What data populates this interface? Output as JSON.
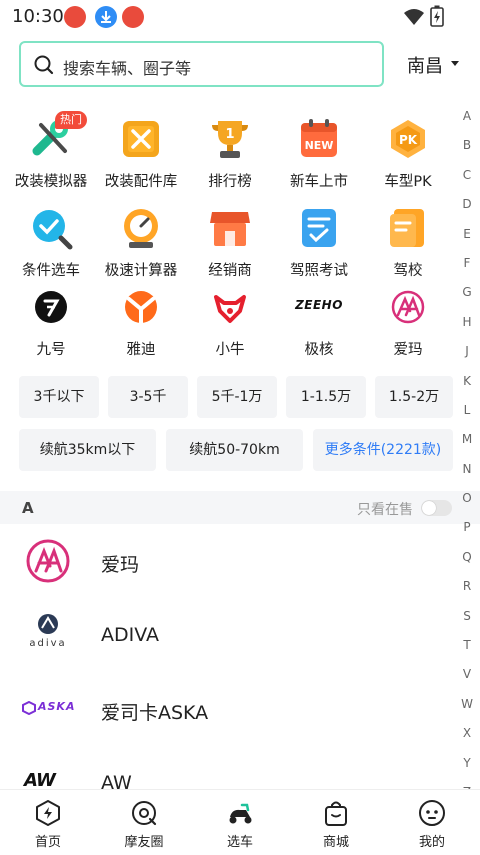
{
  "status_bar": {
    "time": "10:30"
  },
  "search": {
    "placeholder": "搜索车辆、圈子等"
  },
  "location": {
    "city": "南昌"
  },
  "tools": [
    {
      "label": "改装模拟器",
      "badge": "热门",
      "icon": "wrench-icon"
    },
    {
      "label": "改装配件库",
      "icon": "parts-box-icon"
    },
    {
      "label": "排行榜",
      "icon": "trophy-icon"
    },
    {
      "label": "新车上市",
      "icon": "new-calendar-icon"
    },
    {
      "label": "车型PK",
      "icon": "pk-icon"
    },
    {
      "label": "条件选车",
      "icon": "magnifier-check-icon"
    },
    {
      "label": "极速计算器",
      "icon": "speedometer-icon"
    },
    {
      "label": "经销商",
      "icon": "store-icon"
    },
    {
      "label": "驾照考试",
      "icon": "exam-icon"
    },
    {
      "label": "驾校",
      "icon": "school-icon"
    }
  ],
  "brand_shortcuts": [
    {
      "label": "九号",
      "icon": "ninebot-logo"
    },
    {
      "label": "雅迪",
      "icon": "yadea-logo"
    },
    {
      "label": "小牛",
      "icon": "niu-logo"
    },
    {
      "label": "极核",
      "icon": "zeeho-logo",
      "logo_text": "ZEEHO"
    },
    {
      "label": "爱玛",
      "icon": "aima-logo"
    }
  ],
  "filters": {
    "price": [
      "3千以下",
      "3-5千",
      "5千-1万",
      "1-1.5万",
      "1.5-2万"
    ],
    "range": [
      "续航35km以下",
      "续航50-70km"
    ],
    "more": "更多条件(2221款)"
  },
  "brand_list": {
    "section_letter": "A",
    "only_on_sale_label": "只看在售",
    "only_on_sale": false,
    "items": [
      {
        "name": "爱玛",
        "logo": "aima-logo"
      },
      {
        "name": "ADIVA",
        "logo": "adiva-logo",
        "logo_text": "adiva"
      },
      {
        "name": "爱司卡ASKA",
        "logo": "aska-logo",
        "logo_text": "ASKA"
      },
      {
        "name": "AW",
        "logo": "aw-logo",
        "logo_text": "AW"
      }
    ]
  },
  "index_letters": [
    "A",
    "B",
    "C",
    "D",
    "E",
    "F",
    "G",
    "H",
    "J",
    "K",
    "L",
    "M",
    "N",
    "O",
    "P",
    "Q",
    "R",
    "S",
    "T",
    "V",
    "W",
    "X",
    "Y",
    "Z"
  ],
  "bottom_nav": [
    {
      "label": "首页",
      "icon": "home-bolt-icon"
    },
    {
      "label": "摩友圈",
      "icon": "community-icon"
    },
    {
      "label": "选车",
      "icon": "scooter-icon",
      "active": true
    },
    {
      "label": "商城",
      "icon": "shopping-bag-icon"
    },
    {
      "label": "我的",
      "icon": "profile-face-icon"
    }
  ],
  "colors": {
    "accent": "#1fc29b",
    "link": "#2f7cf6",
    "hot": "#f24b3a",
    "chip_bg": "#f3f4f6"
  }
}
